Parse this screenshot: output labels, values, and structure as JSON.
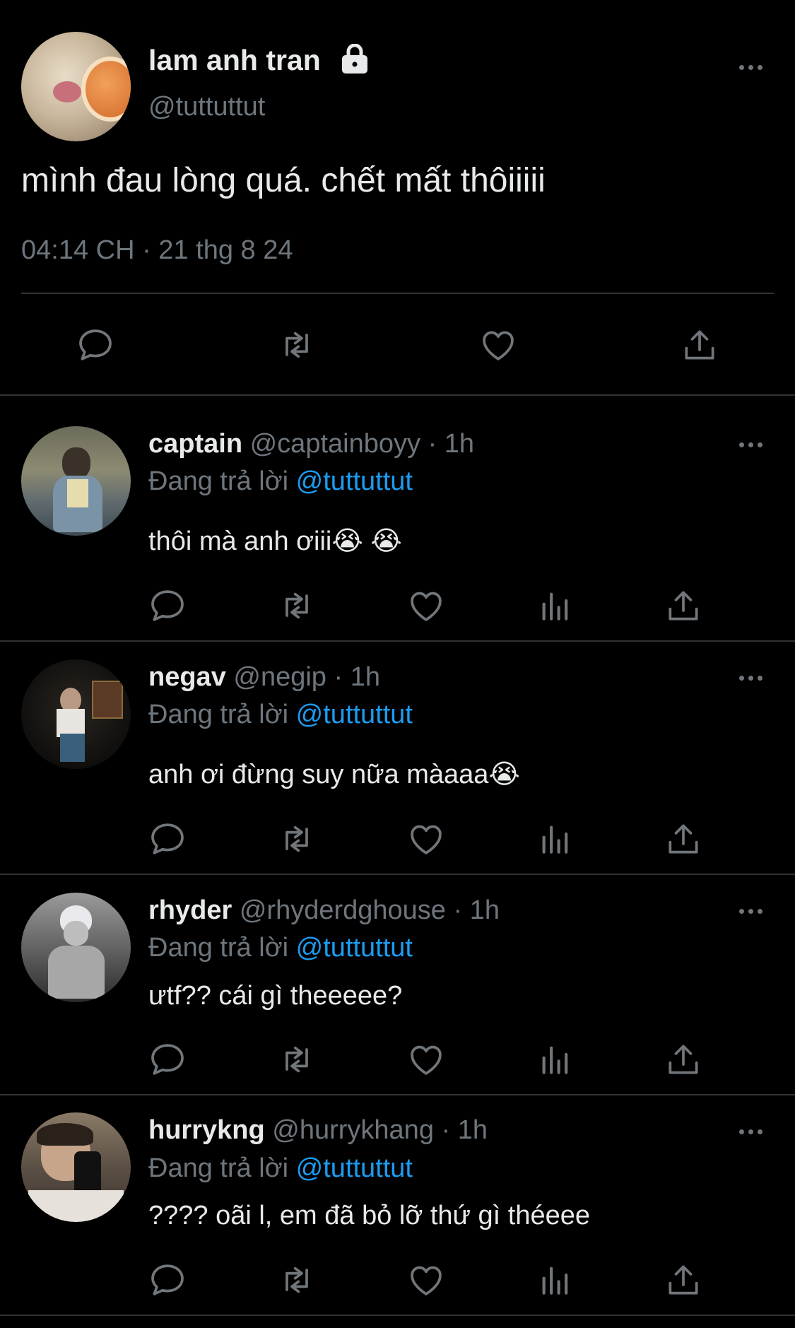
{
  "tweet": {
    "display_name": "lam anh tran",
    "handle": "@tuttuttut",
    "lock_icon": "lock-icon",
    "text": "mình đau lòng quá. chết mất thôiiiii",
    "timestamp": "04:14 CH · 21 thg 8 24",
    "actions": [
      "reply-icon",
      "retweet-icon",
      "like-icon",
      "share-icon"
    ]
  },
  "replying_to_label": "Đang trả lời",
  "replying_to_handle": "@tuttuttut",
  "replies": [
    {
      "name": "captain",
      "handle": "@captainboyy",
      "time": "· 1h",
      "text": "thôi mà anh ơiii😭 😭"
    },
    {
      "name": "negav",
      "handle": "@negip",
      "time": "· 1h",
      "text": "anh ơi đừng suy nữa màaaa😭"
    },
    {
      "name": "rhyder",
      "handle": "@rhyderdghouse",
      "time": "· 1h",
      "text": "ưtf?? cái gì theeeee?"
    },
    {
      "name": "hurrykng",
      "handle": "@hurrykhang",
      "time": "· 1h",
      "text": "???? oãi l, em đã bỏ lỡ thứ gì théeee"
    }
  ],
  "colors": {
    "background": "#000000",
    "text": "#e7e9ea",
    "secondary": "#6e767d",
    "link": "#1d9bf0",
    "divider": "#2f3336"
  }
}
